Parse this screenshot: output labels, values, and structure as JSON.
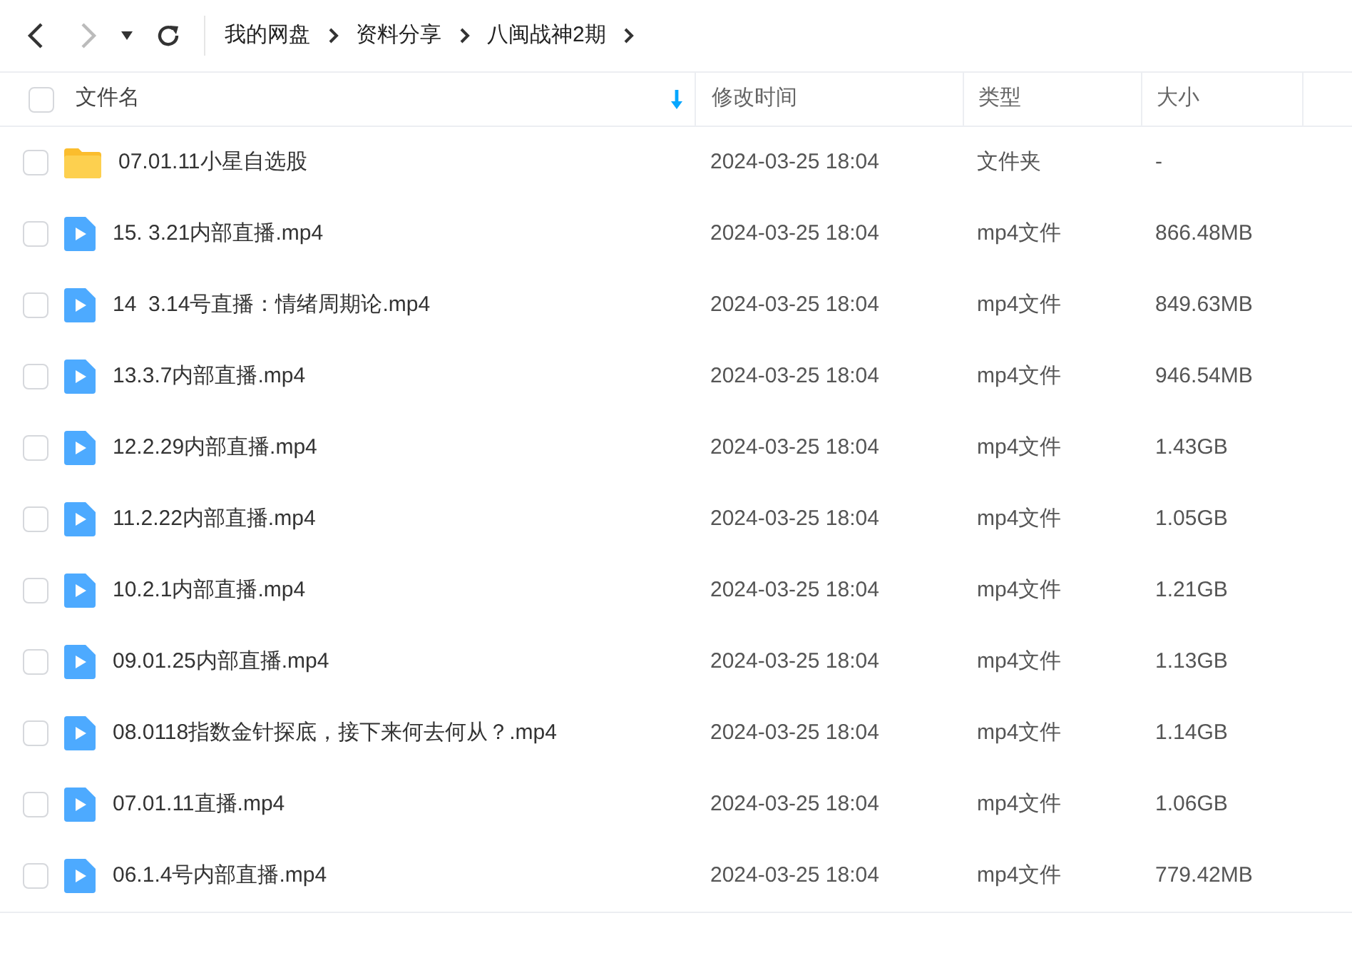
{
  "toolbar": {
    "breadcrumb": [
      {
        "label": "我的网盘"
      },
      {
        "label": "资料分享"
      },
      {
        "label": "八闽战神2期"
      }
    ]
  },
  "table": {
    "select_all_checked": false,
    "columns": [
      {
        "label": "文件名",
        "sorted": true
      },
      {
        "label": "修改时间",
        "sorted": false
      },
      {
        "label": "类型",
        "sorted": false
      },
      {
        "label": "大小",
        "sorted": false
      }
    ],
    "rows": [
      {
        "kind": "folder",
        "checked": false,
        "name": "07.01.11小星自选股",
        "modified": "2024-03-25 18:04",
        "type": "文件夹",
        "size": "-"
      },
      {
        "kind": "video",
        "checked": false,
        "name": "15. 3.21内部直播.mp4",
        "modified": "2024-03-25 18:04",
        "type": "mp4文件",
        "size": "866.48MB"
      },
      {
        "kind": "video",
        "checked": false,
        "name": "14  3.14号直播：情绪周期论.mp4",
        "modified": "2024-03-25 18:04",
        "type": "mp4文件",
        "size": "849.63MB"
      },
      {
        "kind": "video",
        "checked": false,
        "name": "13.3.7内部直播.mp4",
        "modified": "2024-03-25 18:04",
        "type": "mp4文件",
        "size": "946.54MB"
      },
      {
        "kind": "video",
        "checked": false,
        "name": "12.2.29内部直播.mp4",
        "modified": "2024-03-25 18:04",
        "type": "mp4文件",
        "size": "1.43GB"
      },
      {
        "kind": "video",
        "checked": false,
        "name": "11.2.22内部直播.mp4",
        "modified": "2024-03-25 18:04",
        "type": "mp4文件",
        "size": "1.05GB"
      },
      {
        "kind": "video",
        "checked": false,
        "name": "10.2.1内部直播.mp4",
        "modified": "2024-03-25 18:04",
        "type": "mp4文件",
        "size": "1.21GB"
      },
      {
        "kind": "video",
        "checked": false,
        "name": "09.01.25内部直播.mp4",
        "modified": "2024-03-25 18:04",
        "type": "mp4文件",
        "size": "1.13GB"
      },
      {
        "kind": "video",
        "checked": false,
        "name": "08.0118指数金针探底，接下来何去何从？.mp4",
        "modified": "2024-03-25 18:04",
        "type": "mp4文件",
        "size": "1.14GB"
      },
      {
        "kind": "video",
        "checked": false,
        "name": "07.01.11直播.mp4",
        "modified": "2024-03-25 18:04",
        "type": "mp4文件",
        "size": "1.06GB"
      },
      {
        "kind": "video",
        "checked": false,
        "name": "06.1.4号内部直播.mp4",
        "modified": "2024-03-25 18:04",
        "type": "mp4文件",
        "size": "779.42MB"
      }
    ]
  }
}
